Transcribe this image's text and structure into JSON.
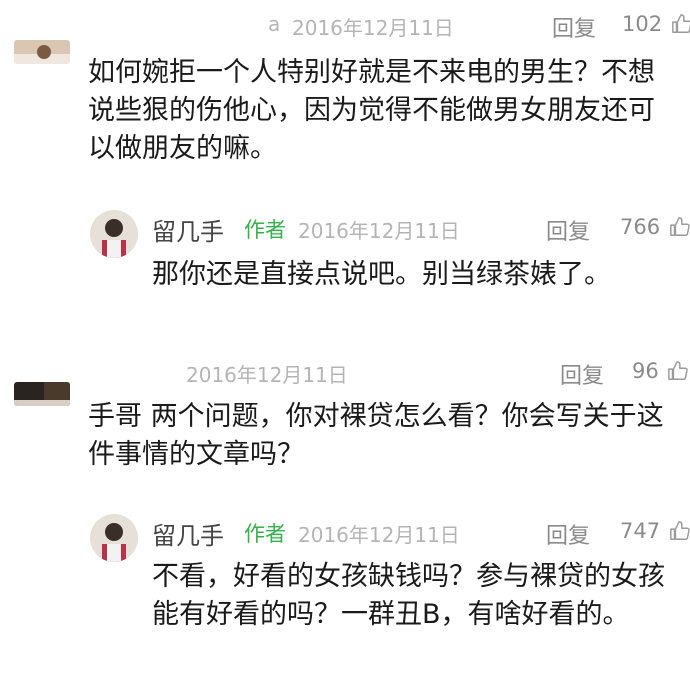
{
  "comments": [
    {
      "username_fragment": "a",
      "date": "2016年12月11日",
      "reply_label": "回复",
      "likes": "102",
      "text": "如何婉拒一个人特别好就是不来电的男生？不想说些狠的伤他心，因为觉得不能做男女朋友还可以做朋友的嘛。",
      "reply": {
        "author": "留几手",
        "badge": "作者",
        "date": "2016年12月11日",
        "reply_label": "回复",
        "likes": "766",
        "text": "那你还是直接点说吧。别当绿茶婊了。"
      }
    },
    {
      "date": "2016年12月11日",
      "reply_label": "回复",
      "likes": "96",
      "text": "手哥 两个问题，你对裸贷怎么看？你会写关于这件事情的文章吗？",
      "reply": {
        "author": "留几手",
        "badge": "作者",
        "date": "2016年12月11日",
        "reply_label": "回复",
        "likes": "747",
        "text": "不看，好看的女孩缺钱吗？参与裸贷的女孩能有好看的吗？一群丑B，有啥好看的。"
      }
    }
  ],
  "icons": [
    "thumbs-up-icon"
  ]
}
